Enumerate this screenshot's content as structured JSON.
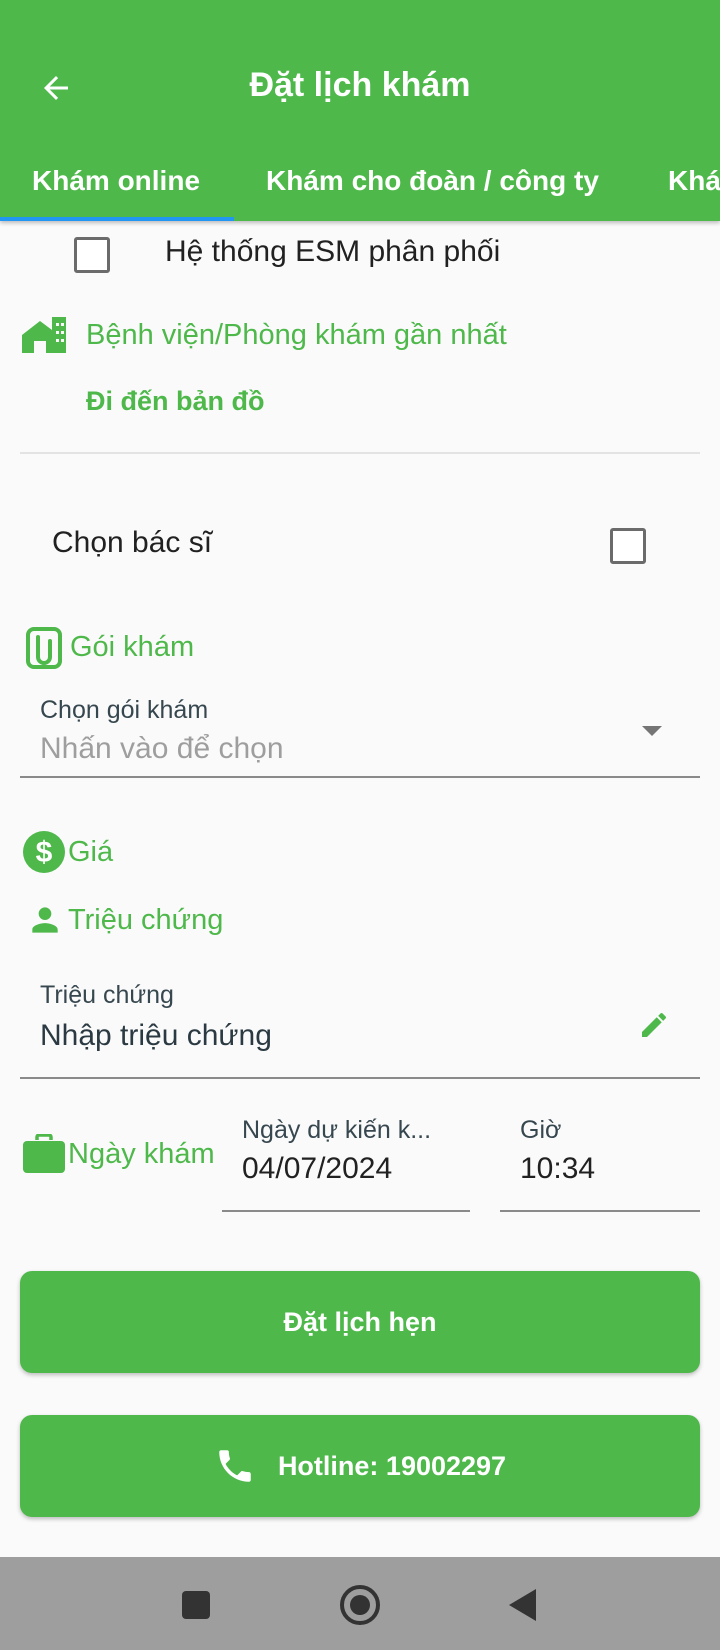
{
  "app_bar": {
    "title": "Đặt lịch khám",
    "back_icon": "arrow-left-icon"
  },
  "tabs": [
    {
      "label": "Khám online",
      "selected": true
    },
    {
      "label": "Khám cho đoàn / công ty",
      "selected": false
    },
    {
      "label": "Khám",
      "selected": false
    }
  ],
  "esm": {
    "label": "Hệ thống ESM phân phối",
    "checked": false
  },
  "nearest": {
    "heading": "Bệnh viện/Phòng khám gần nhất",
    "map_link": "Đi đến bản đồ"
  },
  "doctor": {
    "label": "Chọn bác sĩ",
    "checked": false
  },
  "package": {
    "heading": "Gói khám",
    "field_label": "Chọn gói khám",
    "placeholder": "Nhấn vào để chọn"
  },
  "price": {
    "heading": "Giá"
  },
  "symptoms": {
    "heading": "Triệu chứng",
    "field_label": "Triệu chứng",
    "value": "Nhập triệu chứng"
  },
  "appointment": {
    "heading": "Ngày khám",
    "date_label": "Ngày dự kiến k...",
    "date_value": "04/07/2024",
    "time_label": "Giờ",
    "time_value": "10:34"
  },
  "buttons": {
    "book": "Đặt lịch hẹn",
    "hotline": "Hotline: 19002297"
  },
  "colors": {
    "primary": "#4eb84b",
    "tab_indicator": "#2196f3",
    "nav_bar": "#9e9e9e"
  }
}
